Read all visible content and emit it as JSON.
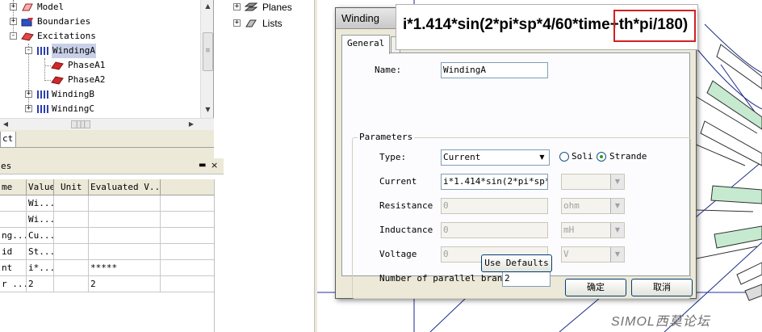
{
  "project_tree": {
    "items": [
      {
        "label": "Model",
        "expander": "+"
      },
      {
        "label": "Boundaries",
        "expander": "+"
      },
      {
        "label": "Excitations",
        "expander": "-"
      },
      {
        "label": "WindingA",
        "expander": "-"
      },
      {
        "label": "PhaseA1",
        "expander": ""
      },
      {
        "label": "PhaseA2",
        "expander": ""
      },
      {
        "label": "WindingB",
        "expander": "+"
      },
      {
        "label": "WindingC",
        "expander": "+"
      }
    ]
  },
  "tabs": {
    "project_tab": "ct"
  },
  "properties": {
    "title": "es",
    "pin_glyph": "▬",
    "close_glyph": "×",
    "columns": [
      "me",
      "Value",
      "Unit",
      "Evaluated V..."
    ],
    "rows": [
      [
        "",
        "Wi...",
        "",
        ""
      ],
      [
        "",
        "Wi...",
        "",
        ""
      ],
      [
        "ng...",
        "Cu...",
        "",
        ""
      ],
      [
        "id",
        "St...",
        "",
        ""
      ],
      [
        "nt",
        "i*...",
        "",
        "*****"
      ],
      [
        "r ...",
        "2",
        "",
        "2"
      ]
    ]
  },
  "middle_tree": {
    "items": [
      {
        "label": "Planes",
        "expander": "+"
      },
      {
        "label": "Lists",
        "expander": "+"
      }
    ]
  },
  "dialog": {
    "title": "Winding",
    "tabs": [
      "General",
      ""
    ],
    "name_label": "Name:",
    "name_value": "WindingA",
    "params_legend": "Parameters",
    "type_label": "Type:",
    "type_value": "Current",
    "solid_label": "Soli",
    "stranded_label": "Strande",
    "current_label": "Current",
    "current_value": "i*1.414*sin(2*pi*sp*4/",
    "resistance_label": "Resistance",
    "resistance_value": "0",
    "resistance_unit": "ohm",
    "inductance_label": "Inductance",
    "inductance_value": "0",
    "inductance_unit": "mH",
    "voltage_label": "Voltage",
    "voltage_value": "0",
    "voltage_unit": "V",
    "parallel_label": "Number of parallel branc",
    "parallel_value": "2",
    "use_defaults": "Use Defaults",
    "ok": "确定",
    "cancel": "取消"
  },
  "formula_tooltip": "i*1.414*sin(2*pi*sp*4/60*time+th*pi/180)",
  "watermark": "SIMOL西莫论坛",
  "colors": {
    "winding_icon": "#2b3fb0",
    "phase_icon": "#d02828",
    "highlight_border": "#d42020",
    "modeler_lines": "#1a2a8a",
    "slot_fill": "#c6ead0"
  }
}
